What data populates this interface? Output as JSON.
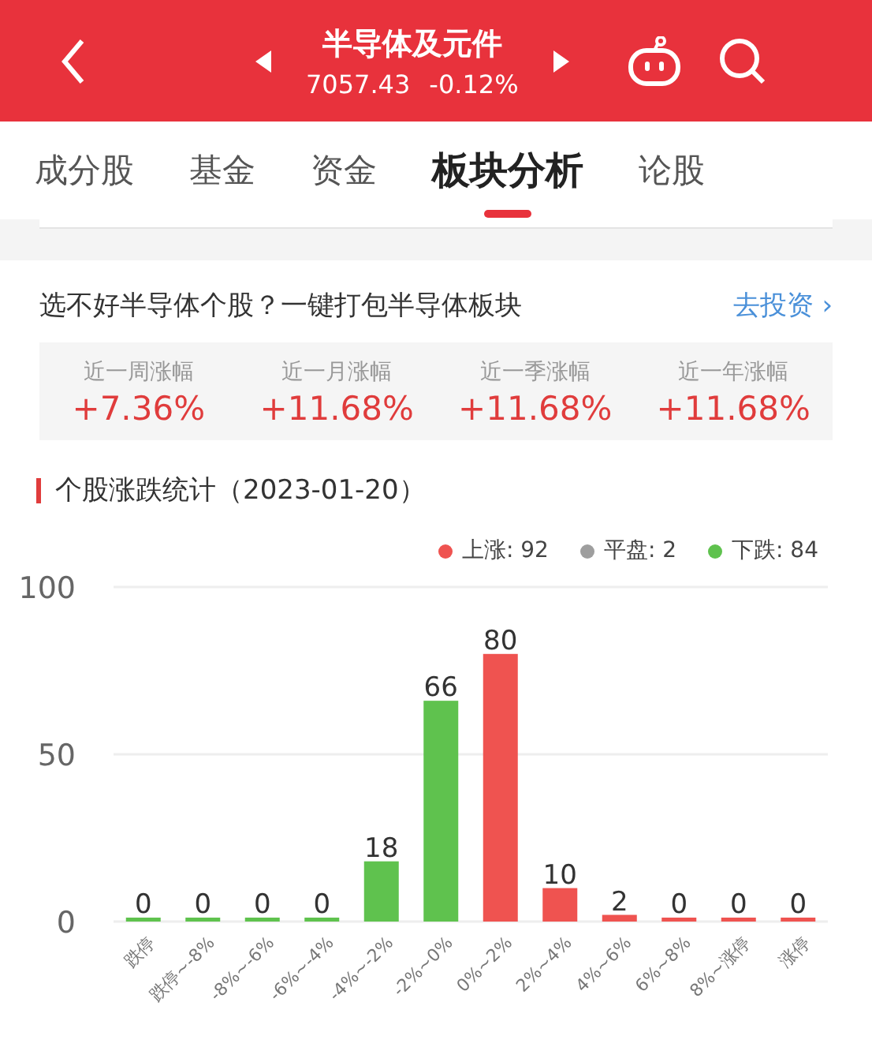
{
  "header": {
    "title": "半导体及元件",
    "price": "7057.43",
    "change": "-0.12%"
  },
  "tabs": [
    {
      "label": "成分股",
      "selected": false
    },
    {
      "label": "基金",
      "selected": false
    },
    {
      "label": "资金",
      "selected": false
    },
    {
      "label": "板块分析",
      "selected": true
    },
    {
      "label": "论股",
      "selected": false
    }
  ],
  "promo": {
    "text": "选不好半导体个股？一键打包半导体板块",
    "link": "去投资",
    "arrow": "›"
  },
  "stats": [
    {
      "label": "近一周涨幅",
      "value": "+7.36%"
    },
    {
      "label": "近一月涨幅",
      "value": "+11.68%"
    },
    {
      "label": "近一季涨幅",
      "value": "+11.68%"
    },
    {
      "label": "近一年涨幅",
      "value": "+11.68%"
    }
  ],
  "distribution": {
    "title": "个股涨跌统计（2023-01-20）",
    "legend": [
      {
        "label": "上涨: 92",
        "color": "#ef5350"
      },
      {
        "label": "平盘: 2",
        "color": "#9e9e9e"
      },
      {
        "label": "下跌: 84",
        "color": "#5fc24e"
      }
    ],
    "chart_data": {
      "type": "bar",
      "categories": [
        "跌停",
        "跌停~-8%",
        "-8%~-6%",
        "-6%~-4%",
        "-4%~-2%",
        "-2%~0%",
        "0%~2%",
        "2%~4%",
        "4%~6%",
        "6%~8%",
        "8%~涨停",
        "涨停"
      ],
      "series": [
        {
          "color": "#5fc24e",
          "values": [
            0,
            0,
            0,
            0,
            18,
            66,
            null,
            null,
            null,
            null,
            null,
            null
          ]
        },
        {
          "color": "#ef5350",
          "values": [
            null,
            null,
            null,
            null,
            null,
            null,
            80,
            10,
            2,
            0,
            0,
            0
          ]
        }
      ],
      "stacked": true,
      "ylim": [
        0,
        100
      ],
      "yticks": [
        0,
        50,
        100
      ],
      "data_labels": true
    }
  }
}
